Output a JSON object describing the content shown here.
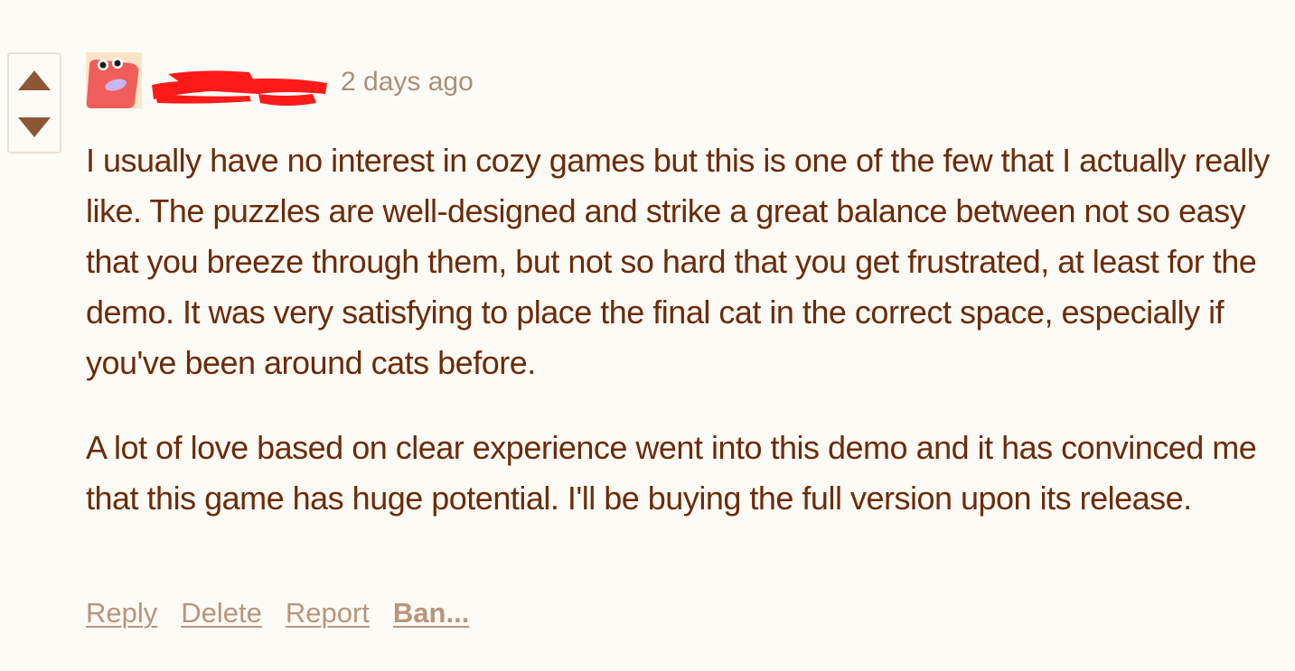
{
  "comment": {
    "timestamp": "2 days ago",
    "paragraphs": [
      "I usually have no interest in cozy games but this is one of the few that I actually really like. The puzzles are well-designed and strike a great balance between not so easy that you breeze through them, but not so hard that you get frustrated, at least for the demo. It was very satisfying to place the final cat in the correct space, especially if you've been around cats before.",
      "A lot of love based on clear experience went into this demo and it has convinced me that this game has huge potential. I'll be buying the full version upon its release."
    ],
    "actions": {
      "reply": "Reply",
      "delete": "Delete",
      "report": "Report",
      "ban": "Ban..."
    }
  },
  "colors": {
    "background": "#fdfbf5",
    "body_text": "#6b2b09",
    "muted": "#ab8f7b",
    "vote_arrow": "#8d5735",
    "redaction": "#ff1a1a"
  },
  "icons": {
    "upvote": "triangle-up",
    "downvote": "triangle-down",
    "avatar": "red-creature-avatar"
  }
}
